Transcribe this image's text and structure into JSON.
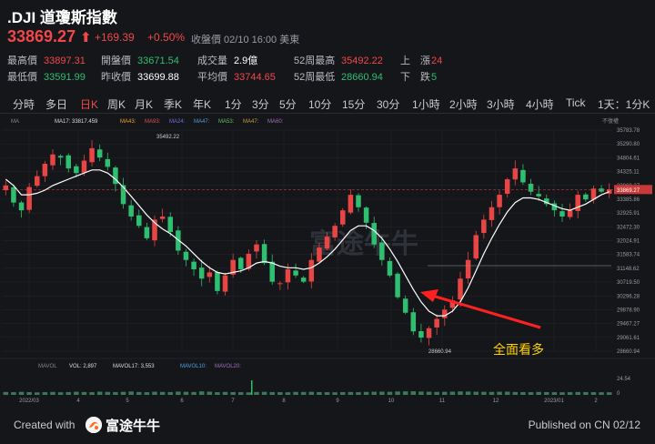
{
  "header": {
    "title": ".DJI 道瓊斯指數",
    "price": "33869.27",
    "change": "+169.39",
    "change_pct": "+0.50%",
    "close_info": "收盤價 02/10 16:00 美東",
    "stats": [
      {
        "label": "最高價",
        "value": "33897.31",
        "tone": "red"
      },
      {
        "label": "開盤價",
        "value": "33671.54",
        "tone": "green"
      },
      {
        "label": "成交量",
        "value": "2.9億",
        "tone": "white"
      },
      {
        "label": "52周最高",
        "value": "35492.22",
        "tone": "red"
      },
      {
        "label": "上　漲",
        "value": "24",
        "tone": "red"
      },
      {
        "label": "最低價",
        "value": "33591.99",
        "tone": "green"
      },
      {
        "label": "昨收價",
        "value": "33699.88",
        "tone": "white"
      },
      {
        "label": "平均價",
        "value": "33744.65",
        "tone": "red"
      },
      {
        "label": "52周最低",
        "value": "28660.94",
        "tone": "green"
      },
      {
        "label": "下　跌",
        "value": "5",
        "tone": "green"
      }
    ]
  },
  "tabs": [
    "分時",
    "多日",
    "日K",
    "周K",
    "月K",
    "季K",
    "年K",
    "1分",
    "3分",
    "5分",
    "10分",
    "15分",
    "30分",
    "1小時",
    "2小時",
    "3小時",
    "4小時",
    "Tick",
    "1天：1分K"
  ],
  "active_tab": "日K",
  "indicators": {
    "ma_label": "MA",
    "ma17": "MA17: 33817.459",
    "ma_others": [
      "MA43:",
      "MA93:",
      "MA24:",
      "MA47:",
      "MA53:",
      "MA47:",
      "MA60:"
    ],
    "no_adjust": "不復權",
    "mavol_label": "MAVOL",
    "vol": "VOL: 2,897",
    "mavol17": "MAVOL17: 3,553",
    "mavol_others": [
      "MAVOL10:",
      "MAVOL20:"
    ]
  },
  "chart_data": {
    "type": "candlestick",
    "y_ticks": [
      "35783.78",
      "35290.80",
      "34804.61",
      "34325.11",
      "33869.27",
      "33385.86",
      "32925.91",
      "32472.30",
      "32024.91",
      "31583.74",
      "31148.62",
      "30719.50",
      "30296.28",
      "29878.90",
      "29467.27",
      "29061.61",
      "28660.94"
    ],
    "ylim": [
      28660.94,
      35783.78
    ],
    "x_ticks": [
      "2022/03",
      "4",
      "5",
      "6",
      "7",
      "8",
      "9",
      "10",
      "11",
      "12",
      "2023/01",
      "2"
    ],
    "last_price": 33869.27,
    "high_annotation": "35492.22",
    "low_annotation": "28660.94",
    "close_series": [
      34000,
      33450,
      33200,
      33950,
      34300,
      34700,
      35000,
      34900,
      34550,
      34400,
      34800,
      35200,
      34900,
      34600,
      34050,
      33400,
      33000,
      32700,
      32300,
      32900,
      33000,
      32500,
      31900,
      31600,
      31300,
      31000,
      31200,
      30600,
      31100,
      31600,
      31300,
      31800,
      32100,
      31500,
      30900,
      30850,
      31300,
      31100,
      30900,
      31600,
      32000,
      32350,
      32700,
      33200,
      33700,
      33300,
      32800,
      32100,
      31600,
      31100,
      30400,
      29900,
      29300,
      29100,
      29400,
      29700,
      30000,
      30300,
      31000,
      31600,
      32400,
      32900,
      33300,
      33700,
      34200,
      34550,
      34100,
      33800,
      33650,
      33400,
      33200,
      33000,
      33200,
      33700,
      33550,
      33900,
      33800,
      33870
    ],
    "ma_series": [
      34200,
      34000,
      33700,
      33700,
      33750,
      33850,
      34000,
      34100,
      34200,
      34300,
      34400,
      34500,
      34500,
      34400,
      34200,
      33950,
      33650,
      33350,
      33050,
      32800,
      32600,
      32450,
      32250,
      32050,
      31800,
      31550,
      31350,
      31200,
      31150,
      31200,
      31250,
      31350,
      31500,
      31550,
      31500,
      31400,
      31350,
      31350,
      31300,
      31350,
      31500,
      31700,
      31950,
      32250,
      32550,
      32700,
      32700,
      32550,
      32300,
      31950,
      31550,
      31100,
      30650,
      30250,
      29950,
      29800,
      29800,
      29950,
      30250,
      30700,
      31250,
      31800,
      32300,
      32750,
      33150,
      33450,
      33600,
      33600,
      33550,
      33450,
      33350,
      33250,
      33200,
      33300,
      33400,
      33550,
      33700,
      33800
    ],
    "volume_series": [
      3.2,
      3.0,
      3.4,
      3.1,
      2.8,
      3.0,
      3.3,
      2.9,
      3.1,
      3.5,
      3.2,
      3.0,
      3.6,
      3.3,
      3.1,
      3.4,
      3.8,
      3.2,
      3.0,
      3.5,
      3.3,
      3.1,
      3.7,
      3.4,
      3.2,
      3.9,
      3.6,
      3.0,
      3.3,
      3.1,
      3.0,
      2.8,
      3.2,
      3.4,
      3.1,
      3.0,
      2.9,
      3.3,
      3.2,
      3.4,
      3.1,
      3.0,
      2.9,
      3.1,
      3.2,
      3.0,
      3.3,
      3.5,
      3.6,
      3.4,
      3.8,
      3.9,
      4.1,
      3.7,
      3.5,
      3.3,
      3.4,
      3.6,
      3.9,
      3.7,
      3.5,
      3.4,
      3.3,
      3.5,
      3.6,
      3.2,
      3.1,
      3.0,
      3.3,
      3.1,
      3.0,
      2.9,
      3.0,
      3.2,
      3.1,
      3.0,
      2.9,
      2.9
    ],
    "volume_axis_label": "24.54",
    "volume_axis_zero": "0"
  },
  "annotation": {
    "text": "全面看多"
  },
  "watermark": "富途牛牛",
  "footer": {
    "created": "Created with",
    "brand": "富途牛牛",
    "published": "Published on CN 02/12"
  }
}
